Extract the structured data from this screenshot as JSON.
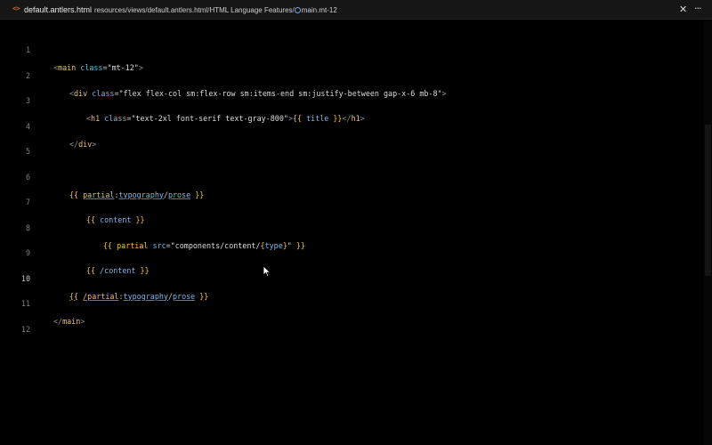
{
  "tab": {
    "icon": "code-brackets-icon",
    "filename": "default.antlers.html",
    "breadcrumb": [
      "resources",
      "views",
      "default.antlers.html",
      "HTML Language Features",
      "main.mt-12"
    ]
  },
  "actions": {
    "close_icon": "close-icon",
    "more_icon": "more-actions-icon"
  },
  "editor": {
    "lines": [
      {
        "number": "1"
      },
      {
        "number": "2"
      },
      {
        "number": "3"
      },
      {
        "number": "4"
      },
      {
        "number": "5"
      },
      {
        "number": "6"
      },
      {
        "number": "7"
      },
      {
        "number": "8"
      },
      {
        "number": "9"
      },
      {
        "number": "10"
      },
      {
        "number": "11"
      },
      {
        "number": "12"
      }
    ],
    "active_line": "10",
    "code": {
      "l1_tag": "main",
      "l1_attr": "class",
      "l1_val": "\"mt-12\"",
      "l1_close_tag": "main",
      "l2_tag": "div",
      "l2_attr": "class",
      "l2_val": "\"flex flex-col sm:flex-row sm:items-end sm:justify-between gap-x-6 mb-8\"",
      "l2_close_tag": "div",
      "l3_tag": "h1",
      "l3_attr": "class",
      "l3_val": "\"text-2xl font-serif text-gray-800\"",
      "l3_var": "title",
      "l3_close_tag": "h1",
      "partial_kw": "partial",
      "partial_arg1": "typography",
      "partial_arg2": "prose",
      "close_partial_kw": "/partial",
      "content_kw": "content",
      "close_content_kw": "/content",
      "l8_kw": "partial",
      "l8_attr": "src",
      "l8_str": "\"components/content/",
      "l8_var": "type",
      "l8_str_end": "\""
    }
  }
}
